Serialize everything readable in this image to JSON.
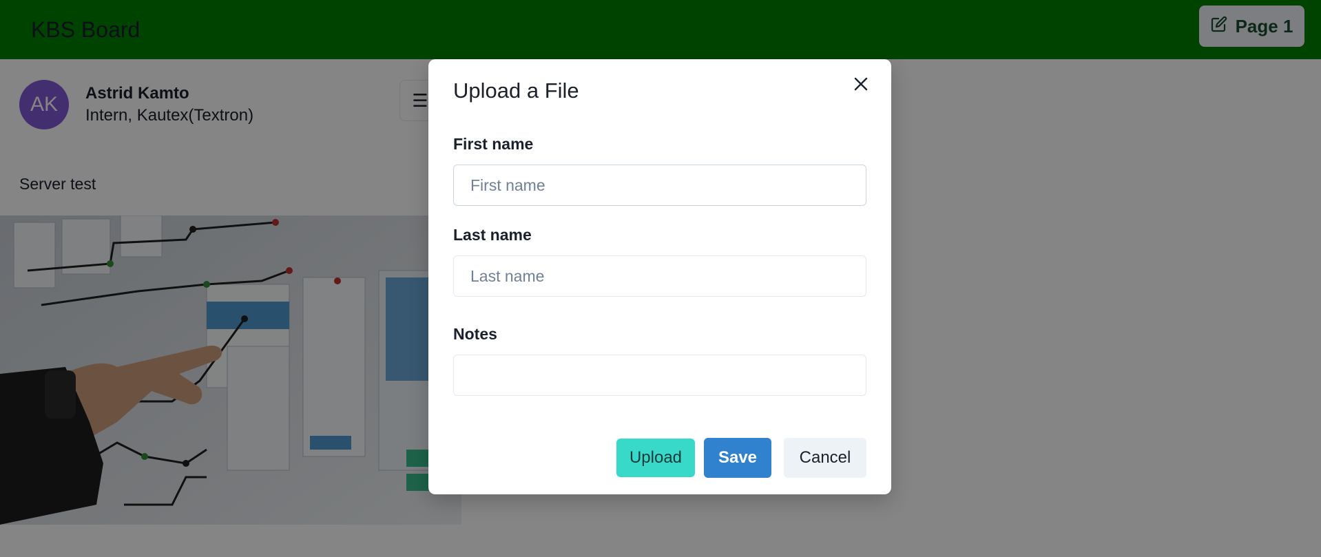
{
  "header": {
    "brand": "KBS Board",
    "page_button_label": "Page 1",
    "page_button_icon": "edit-icon"
  },
  "profile": {
    "initials": "AK",
    "name": "Astrid Kamto",
    "role": "Intern, Kautex(Textron)"
  },
  "menu_button_icon": "hamburger-icon",
  "post": {
    "title": "Server test"
  },
  "modal": {
    "title": "Upload a File",
    "close_icon": "close-icon",
    "fields": {
      "first_name": {
        "label": "First name",
        "placeholder": "First name",
        "value": ""
      },
      "last_name": {
        "label": "Last name",
        "placeholder": "Last name",
        "value": ""
      },
      "notes": {
        "label": "Notes",
        "placeholder": "",
        "value": ""
      }
    },
    "buttons": {
      "upload": "Upload",
      "save": "Save",
      "cancel": "Cancel"
    }
  },
  "colors": {
    "header_bg": "#008000",
    "avatar_bg": "#805ad5",
    "upload_bg": "#38d9c9",
    "save_bg": "#3182ce",
    "cancel_bg": "#edf2f7"
  }
}
